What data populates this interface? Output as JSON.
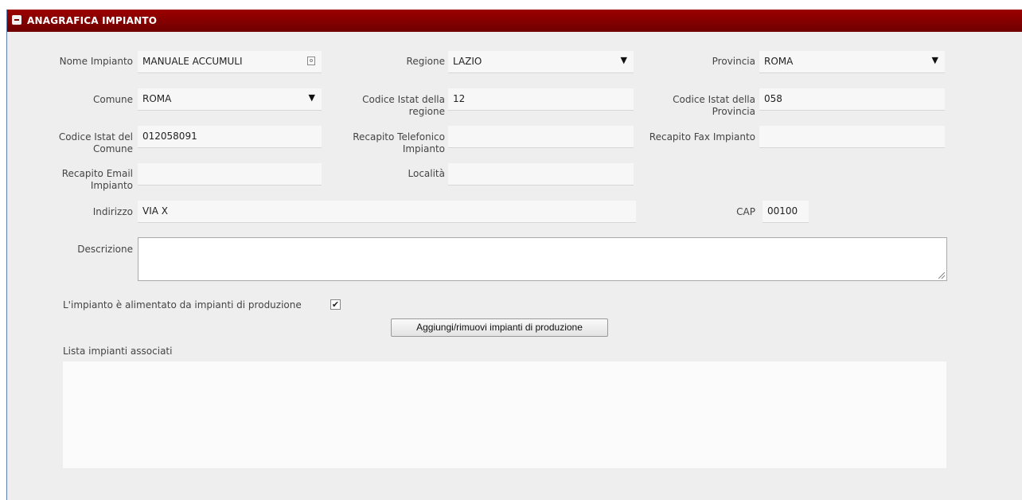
{
  "panel": {
    "title": "ANAGRAFICA IMPIANTO"
  },
  "fields": {
    "nome_impianto": {
      "label": "Nome Impianto",
      "value": "MANUALE ACCUMULI"
    },
    "regione": {
      "label": "Regione",
      "value": "LAZIO"
    },
    "provincia": {
      "label": "Provincia",
      "value": "ROMA"
    },
    "comune": {
      "label": "Comune",
      "value": "ROMA"
    },
    "istat_regione": {
      "label_line1": "Codice Istat della",
      "label_line2": "regione",
      "value": "12"
    },
    "istat_provincia": {
      "label_line1": "Codice Istat della",
      "label_line2": "Provincia",
      "value": "058"
    },
    "istat_comune": {
      "label_line1": "Codice Istat del",
      "label_line2": "Comune",
      "value": "012058091"
    },
    "telefono": {
      "label_line1": "Recapito Telefonico",
      "label_line2": "Impianto",
      "value": ""
    },
    "fax": {
      "label": "Recapito Fax Impianto",
      "value": ""
    },
    "email": {
      "label_line1": "Recapito Email",
      "label_line2": "Impianto",
      "value": ""
    },
    "localita": {
      "label": "Località",
      "value": ""
    },
    "indirizzo": {
      "label": "Indirizzo",
      "value": "VIA X"
    },
    "cap": {
      "label": "CAP",
      "value": "00100"
    },
    "descrizione": {
      "label": "Descrizione",
      "value": ""
    }
  },
  "produzione": {
    "checkbox_label": "L'impianto è alimentato da impianti di produzione",
    "checked": true,
    "checkmark": "✔",
    "button_label": "Aggiungi/rimuovi impianti di produzione",
    "list_label": "Lista impianti associati"
  },
  "icons": {
    "select_arrow": "▼"
  }
}
